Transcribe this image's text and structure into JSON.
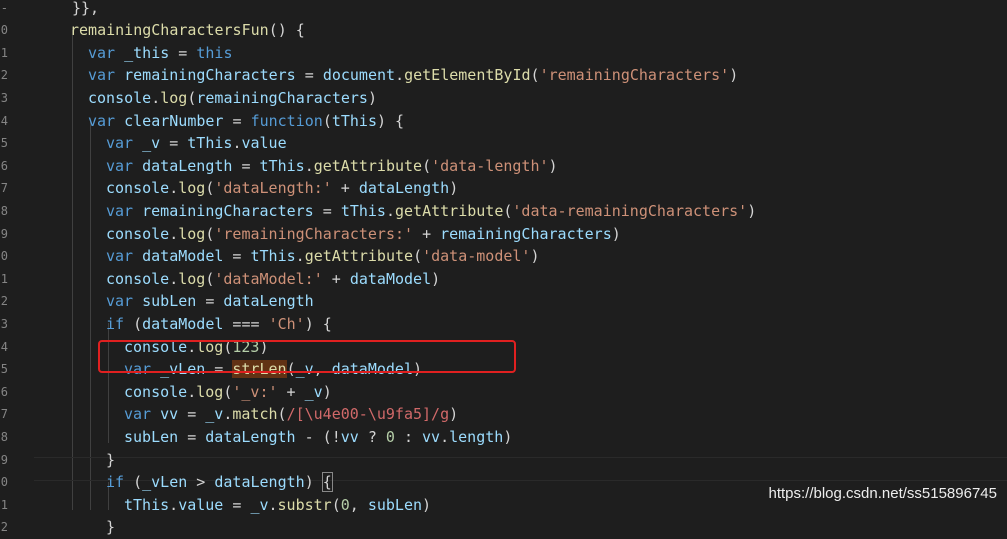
{
  "gutter": [
    "-",
    "0",
    "1",
    "2",
    "3",
    "4",
    "5",
    "6",
    "7",
    "8",
    "9",
    "0",
    "1",
    "2",
    "3",
    "4",
    "5",
    "6",
    "7",
    "8",
    "9",
    "0",
    "1",
    "2"
  ],
  "code": {
    "l0": [
      "}},"
    ],
    "l1": [
      "remainingCharactersFun",
      "() {"
    ],
    "l2": [
      "var",
      " _this",
      " = ",
      "this"
    ],
    "l3": [
      "var",
      " remainingCharacters",
      " = ",
      "document",
      ".",
      "getElementById",
      "(",
      "'remainingCharacters'",
      ")"
    ],
    "l4": [
      "console",
      ".",
      "log",
      "(",
      "remainingCharacters",
      ")"
    ],
    "l5": [
      "var",
      " clearNumber",
      " = ",
      "function",
      "(",
      "tThis",
      ") {"
    ],
    "l6": [
      "var",
      " _v",
      " = ",
      "tThis",
      ".",
      "value"
    ],
    "l7": [
      "var",
      " dataLength",
      " = ",
      "tThis",
      ".",
      "getAttribute",
      "(",
      "'data-length'",
      ")"
    ],
    "l8": [
      "console",
      ".",
      "log",
      "(",
      "'dataLength:'",
      " + ",
      "dataLength",
      ")"
    ],
    "l9": [
      "var",
      " remainingCharacters",
      " = ",
      "tThis",
      ".",
      "getAttribute",
      "(",
      "'data-remainingCharacters'",
      ")"
    ],
    "l10": [
      "console",
      ".",
      "log",
      "(",
      "'remainingCharacters:'",
      " + ",
      "remainingCharacters",
      ")"
    ],
    "l11": [
      "var",
      " dataModel",
      " = ",
      "tThis",
      ".",
      "getAttribute",
      "(",
      "'data-model'",
      ")"
    ],
    "l12": [
      "console",
      ".",
      "log",
      "(",
      "'dataModel:'",
      " + ",
      "dataModel",
      ")"
    ],
    "l13": [
      "var",
      " subLen",
      " = ",
      "dataLength"
    ],
    "l14": [
      "if",
      " (",
      "dataModel",
      " === ",
      "'Ch'",
      ") {"
    ],
    "l15": [
      "console",
      ".",
      "log",
      "(",
      "123",
      ")"
    ],
    "l16": [
      "var",
      " _vLen",
      " = ",
      "strLen",
      "(",
      "_v",
      ", ",
      "dataModel",
      ")"
    ],
    "l17": [
      "console",
      ".",
      "log",
      "(",
      "'_v:'",
      " + ",
      "_v",
      ")"
    ],
    "l18": [
      "var",
      " vv",
      " = ",
      "_v",
      ".",
      "match",
      "(",
      "/[\\u4e00-\\u9fa5]/g",
      ")"
    ],
    "l19": [
      "subLen",
      " = ",
      "dataLength",
      " - (!",
      "vv",
      " ? ",
      "0",
      " : ",
      "vv",
      ".",
      "length",
      ")"
    ],
    "l20": [
      "}"
    ],
    "l21": [
      "if",
      " (",
      "_vLen",
      " > ",
      "dataLength",
      ") ",
      "{"
    ],
    "l22": [
      "tThis",
      ".",
      "value",
      " = ",
      "_v",
      ".",
      "substr",
      "(",
      "0",
      ", ",
      "subLen",
      ")"
    ],
    "l23": [
      "}"
    ]
  },
  "watermark": "https://blog.csdn.net/ss515896745",
  "colors": {
    "background": "#1e1e1e",
    "keyword": "#569cd6",
    "function": "#dcdcaa",
    "variable": "#9cdcfe",
    "string": "#ce9178",
    "number": "#b5cea8",
    "highlight_box": "#e02020"
  }
}
